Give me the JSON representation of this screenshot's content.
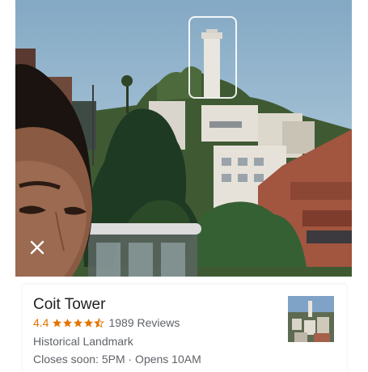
{
  "place": {
    "name": "Coit Tower",
    "rating": "4.4",
    "stars_filled": 4.5,
    "stars_total": 5,
    "reviews": "1989 Reviews",
    "category": "Historical Landmark",
    "hours": "Closes soon: 5PM · Opens 10AM"
  },
  "icons": {
    "close": "close-icon",
    "star": "star-icon"
  },
  "colors": {
    "rating_accent": "#e37400",
    "secondary_text": "#5f6368",
    "primary_text": "#212121"
  }
}
